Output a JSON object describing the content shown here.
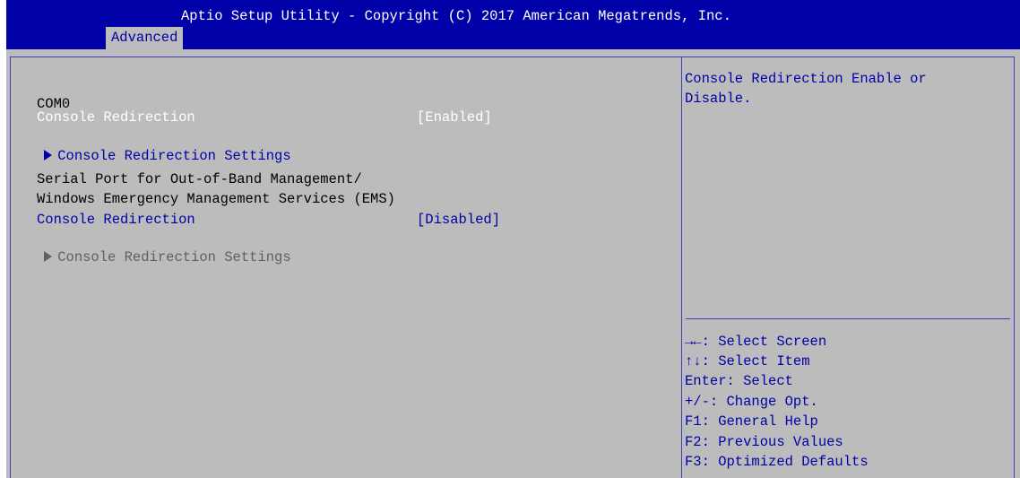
{
  "header": {
    "title": "Aptio Setup Utility - Copyright (C) 2017 American Megatrends, Inc.",
    "active_tab": "Advanced"
  },
  "left": {
    "com0_label": "COM0",
    "com0_redirection_label": "Console Redirection",
    "com0_redirection_value": "[Enabled]",
    "com0_settings_label": "Console Redirection Settings",
    "sol_line1": "Serial Port for Out-of-Band Management/",
    "sol_line2": "Windows Emergency Management Services (EMS)",
    "ems_redirection_label": "Console Redirection",
    "ems_redirection_value": "[Disabled]",
    "ems_settings_label": "Console Redirection Settings"
  },
  "help": {
    "line1": "Console Redirection Enable or",
    "line2": "Disable."
  },
  "keys": [
    "→←: Select Screen",
    "↑↓: Select Item",
    "Enter: Select",
    "+/-: Change Opt.",
    "F1: General Help",
    "F2: Previous Values",
    "F3: Optimized Defaults"
  ],
  "colors": {
    "title_bar": "#0000a8",
    "panel": "#bcbcbc",
    "selected_text": "#ffffff",
    "item_text": "#0000a8",
    "static_text": "#000000",
    "disabled_text": "#606060"
  }
}
